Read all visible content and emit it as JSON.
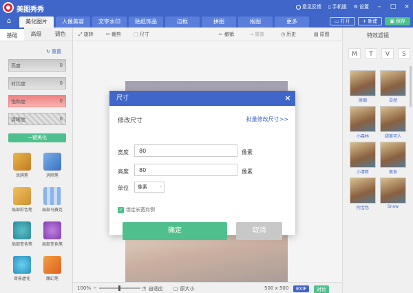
{
  "app": {
    "title": "美图秀秀"
  },
  "titlebar": {
    "feedback": "意见反馈",
    "mobile": "手机版",
    "settings": "设置"
  },
  "nav": {
    "tabs": [
      {
        "label": "美化图片",
        "active": true
      },
      {
        "label": "人像美容"
      },
      {
        "label": "文字水印"
      },
      {
        "label": "贴纸饰品"
      },
      {
        "label": "边框"
      },
      {
        "label": "拼图"
      },
      {
        "label": "抠图"
      },
      {
        "label": "更多"
      }
    ],
    "open": "打开",
    "new": "新建",
    "save": "保存"
  },
  "left": {
    "subtabs": [
      "基础",
      "高级",
      "调色"
    ],
    "reset": "重置",
    "sliders": [
      {
        "label": "亮度",
        "value": "0"
      },
      {
        "label": "对比度",
        "value": "0"
      },
      {
        "label": "饱和度",
        "value": "0"
      },
      {
        "label": "清晰度",
        "value": "0"
      }
    ],
    "one_key": "一键美化",
    "tools": [
      {
        "label": "涂鸦笔"
      },
      {
        "label": "消除笔"
      },
      {
        "label": "局部彩色笔"
      },
      {
        "label": "局部马赛克"
      },
      {
        "label": "局部变色笔"
      },
      {
        "label": "局部变色笔"
      },
      {
        "label": "背景虚化"
      },
      {
        "label": "魔幻笔"
      }
    ]
  },
  "canvas_toolbar": {
    "rotate": "旋转",
    "crop": "裁剪",
    "size": "尺寸",
    "undo": "撤销",
    "redo": "重做",
    "history": "历史",
    "original": "原图"
  },
  "status": {
    "zoom": "100%",
    "fit": "自适应",
    "actual": "原大小",
    "dimensions": "500 x 500",
    "exif": "EXIF",
    "compare": "对比"
  },
  "right": {
    "title": "特效滤镜",
    "tabs": [
      "M",
      "T",
      "V",
      "S"
    ],
    "filters": [
      "原图",
      "自然",
      "小森林",
      "甜美可人",
      "小清新",
      "美食",
      "阿宝色",
      "Snow"
    ]
  },
  "dialog": {
    "title": "尺寸",
    "section": "修改尺寸",
    "batch_link": "批量修改尺寸>>",
    "width_label": "宽度",
    "width_value": "80",
    "height_label": "高度",
    "height_value": "80",
    "pixels": "像素",
    "unit_label": "单位",
    "unit_value": "像素",
    "lock_label": "锁定长宽比例",
    "lock_checked": true,
    "ok": "确定",
    "cancel": "取消"
  },
  "colors": {
    "brand": "#3f66c8",
    "confirm": "#4fc08d",
    "close_app": "#d8263a"
  }
}
